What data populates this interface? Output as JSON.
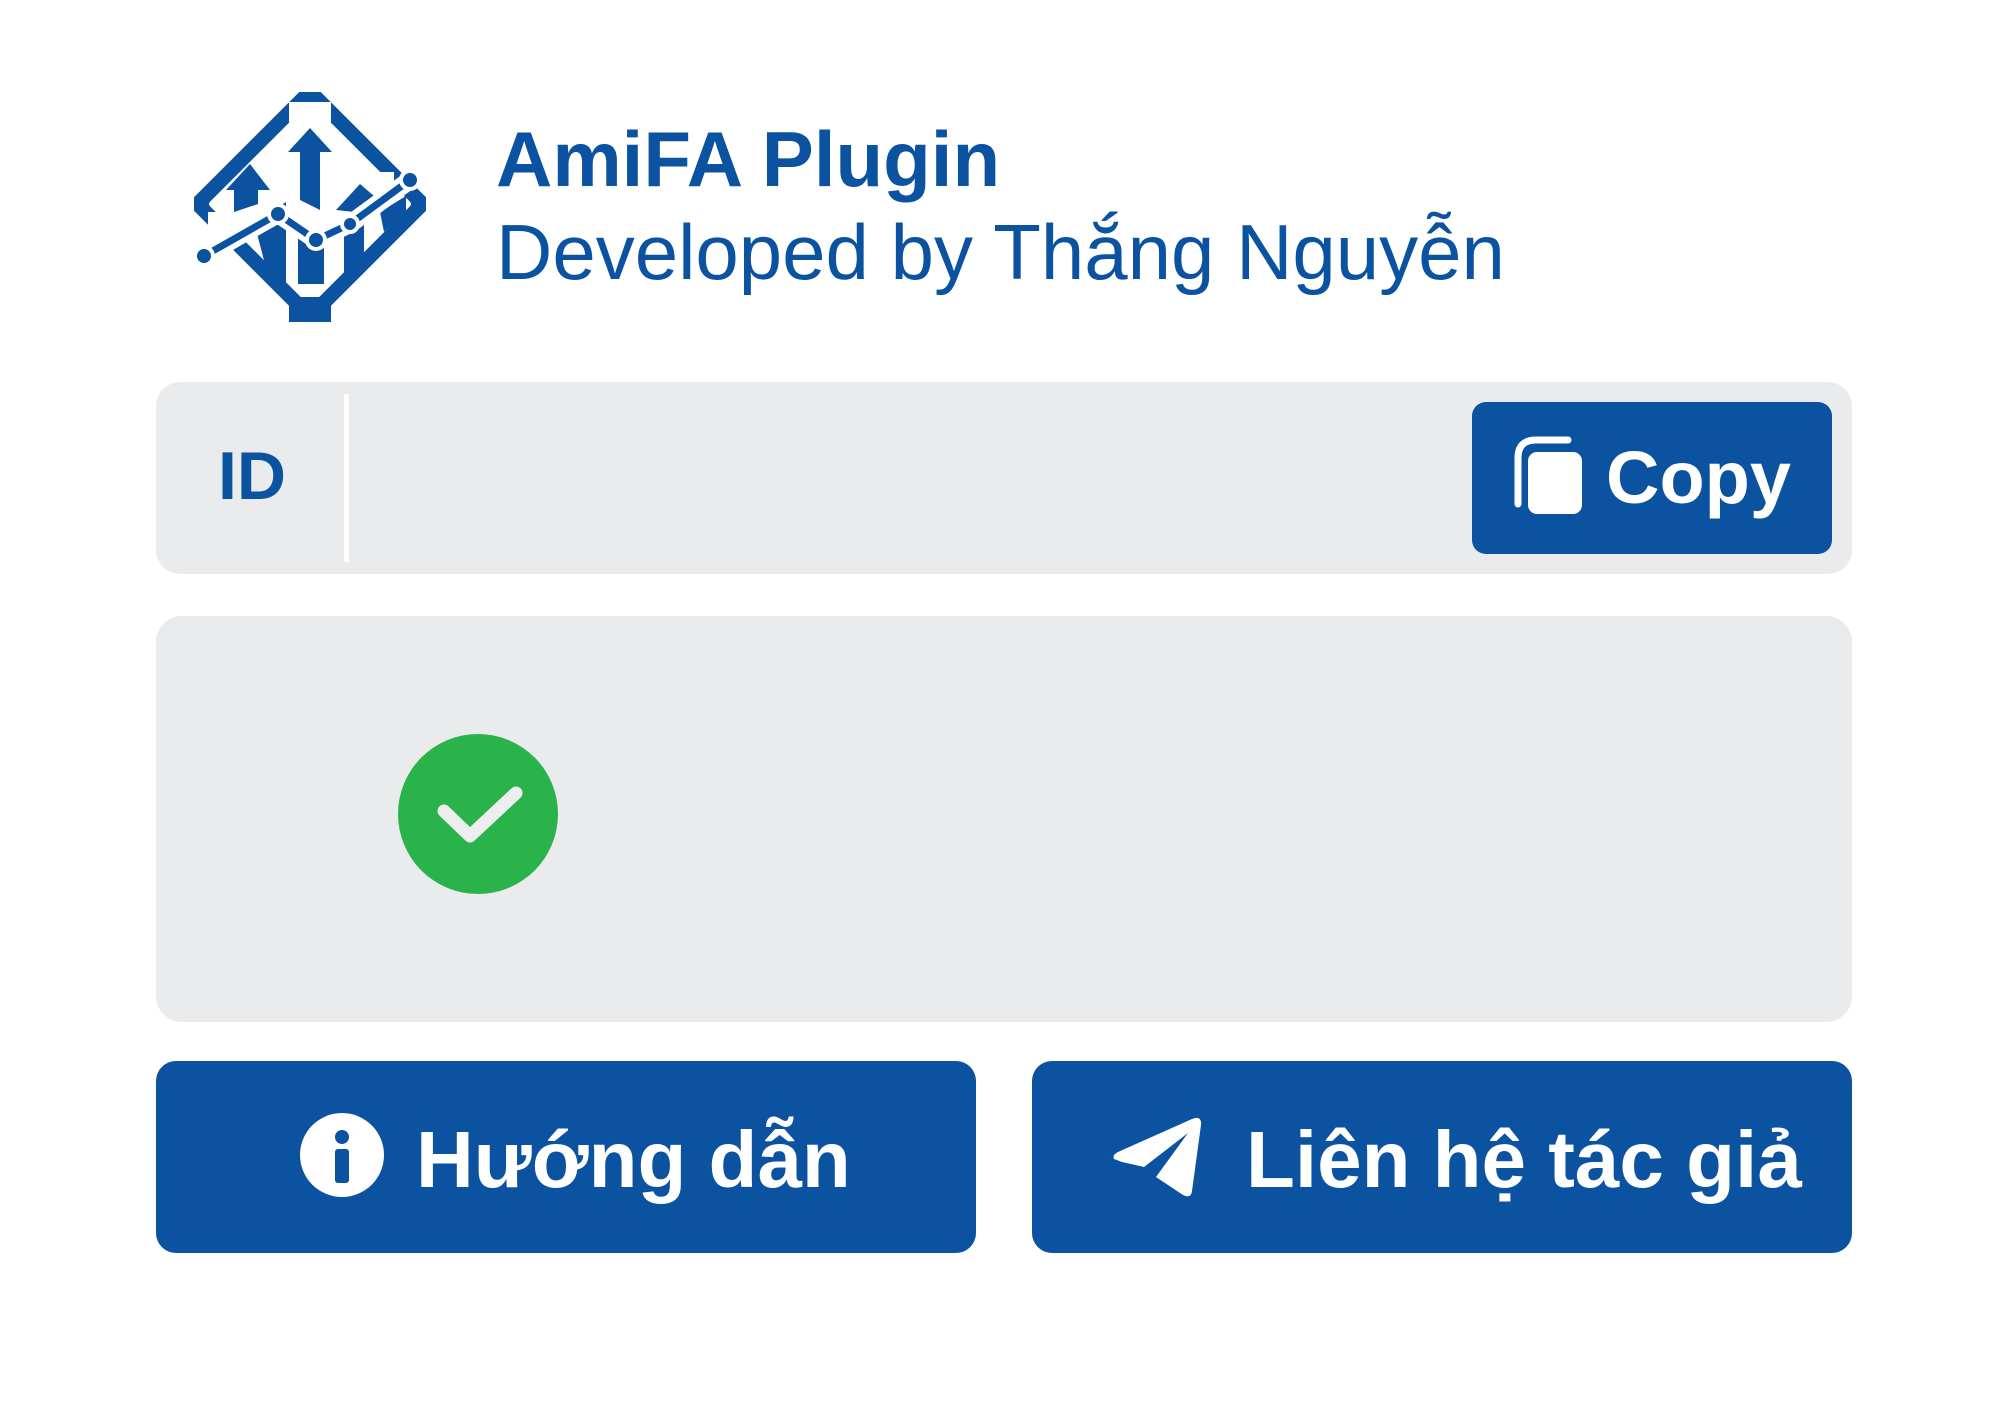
{
  "header": {
    "title": "AmiFA Plugin",
    "subtitle": "Developed by Thắng Nguyễn",
    "logo_icon": "amifa-diamond-chart-logo"
  },
  "id_field": {
    "label": "ID",
    "value": "",
    "copy_label": "Copy",
    "copy_icon": "copy-icon"
  },
  "status": {
    "icon": "check-circle-icon",
    "state": "success",
    "color": "#2bb34b"
  },
  "actions": {
    "guide_label": "Hướng dẫn",
    "guide_icon": "info-icon",
    "contact_label": "Liên hệ tác giả",
    "contact_icon": "telegram-send-icon"
  },
  "colors": {
    "primary": "#0b52a0",
    "panel_background": "#e9ebed",
    "success": "#2bb34b"
  }
}
